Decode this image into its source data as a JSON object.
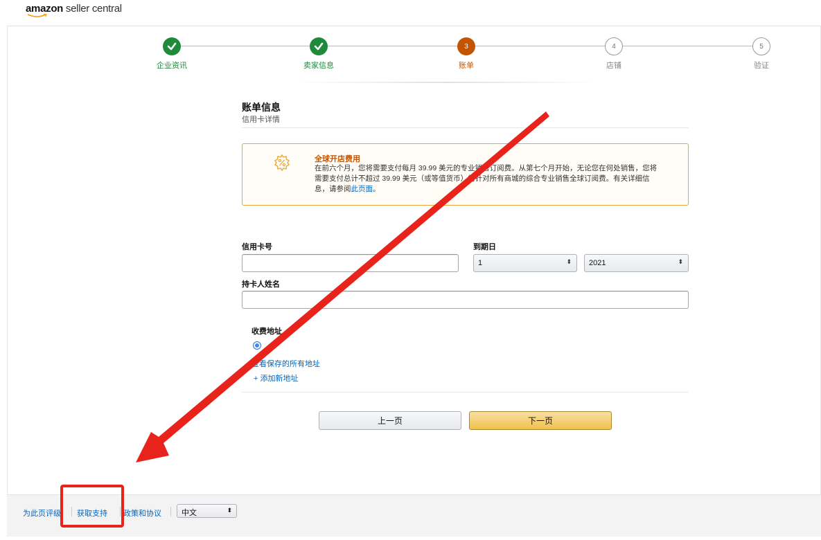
{
  "header": {
    "logo_bold": "amazon",
    "logo_rest": " seller central"
  },
  "stepper": {
    "steps": [
      {
        "label": "企业资讯",
        "state": "done",
        "number": ""
      },
      {
        "label": "卖家信息",
        "state": "done",
        "number": ""
      },
      {
        "label": "账单",
        "state": "current",
        "number": "3"
      },
      {
        "label": "店铺",
        "state": "todo",
        "number": "4"
      },
      {
        "label": "验证",
        "state": "todo",
        "number": "5"
      }
    ]
  },
  "billing": {
    "title": "账单信息",
    "subtitle": "信用卡详情"
  },
  "notice": {
    "icon": "gear-percent-icon",
    "title": "全球开店费用",
    "body_prefix": "在前六个月，您将需要支付每月 39.99 美元的专业销售订阅费。从第七个月开始，无论您在何处销售，您将需要支付总计不超过 39.99 美元（或等值货币）的针对所有商城的综合专业销售全球订阅费。有关详细信息，请参阅",
    "link": "此页面",
    "body_suffix": "。"
  },
  "form": {
    "card_number_label": "信用卡号",
    "card_number_value": "",
    "expiry_label": "到期日",
    "expiry_month": "1",
    "expiry_year": "2021",
    "holder_label": "持卡人姓名",
    "holder_value": ""
  },
  "address": {
    "title": "收费地址",
    "view_all_link": "查看保存的所有地址",
    "add_new_link": "+ 添加新地址"
  },
  "buttons": {
    "prev": "上一页",
    "next": "下一页"
  },
  "footer": {
    "rate_page": "为此页评级",
    "get_support": "获取支持",
    "policies": "政策和协议",
    "language": "中文"
  },
  "colors": {
    "accent_orange": "#c45500",
    "done_green": "#1e8a3a",
    "link_blue": "#0066c0",
    "annotation_red": "#e8231c"
  }
}
